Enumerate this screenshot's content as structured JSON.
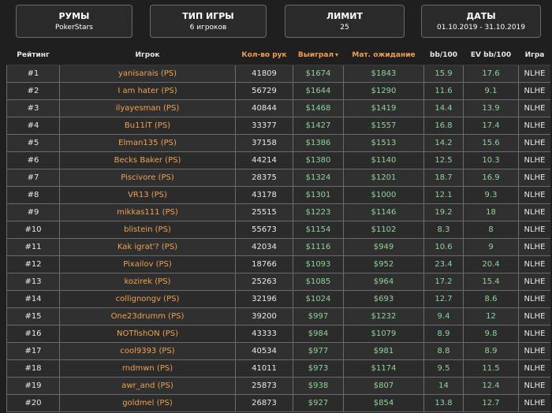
{
  "filters": [
    {
      "title": "РУМЫ",
      "value": "PokerStars"
    },
    {
      "title": "ТИП ИГРЫ",
      "value": "6 игроков"
    },
    {
      "title": "ЛИМИТ",
      "value": "25"
    },
    {
      "title": "ДАТЫ",
      "value": "01.10.2019 - 31.10.2019"
    }
  ],
  "columns": {
    "rank": "Рейтинг",
    "player": "Игрок",
    "hands": "Кол-во рук",
    "won": "Выиграл",
    "won_sort_icon": "caret-down-icon",
    "ev": "Мат. ожидание",
    "bb100": "bb/100",
    "evbb100": "EV bb/100",
    "game": "Игра"
  },
  "sort_arrow": "▾",
  "colors": {
    "accent": "#f0a050",
    "positive": "#8fd39a"
  },
  "rows": [
    {
      "rank": "#1",
      "player": "yanisarais (PS)",
      "hands": "41809",
      "won": "$1674",
      "ev": "$1843",
      "bb100": "15.9",
      "evbb100": "17.6",
      "game": "NLHE"
    },
    {
      "rank": "#2",
      "player": "I am hater (PS)",
      "hands": "56729",
      "won": "$1644",
      "ev": "$1290",
      "bb100": "11.6",
      "evbb100": "9.1",
      "game": "NLHE"
    },
    {
      "rank": "#3",
      "player": "ilyayesman (PS)",
      "hands": "40844",
      "won": "$1468",
      "ev": "$1419",
      "bb100": "14.4",
      "evbb100": "13.9",
      "game": "NLHE"
    },
    {
      "rank": "#4",
      "player": "Bu11iT (PS)",
      "hands": "33377",
      "won": "$1427",
      "ev": "$1557",
      "bb100": "16.8",
      "evbb100": "17.4",
      "game": "NLHE"
    },
    {
      "rank": "#5",
      "player": "Elman135 (PS)",
      "hands": "37158",
      "won": "$1386",
      "ev": "$1513",
      "bb100": "14.2",
      "evbb100": "15.6",
      "game": "NLHE"
    },
    {
      "rank": "#6",
      "player": "Becks Baker (PS)",
      "hands": "44214",
      "won": "$1380",
      "ev": "$1140",
      "bb100": "12.5",
      "evbb100": "10.3",
      "game": "NLHE"
    },
    {
      "rank": "#7",
      "player": "Piscivore (PS)",
      "hands": "28375",
      "won": "$1324",
      "ev": "$1201",
      "bb100": "18.7",
      "evbb100": "16.9",
      "game": "NLHE"
    },
    {
      "rank": "#8",
      "player": "VR13 (PS)",
      "hands": "43178",
      "won": "$1301",
      "ev": "$1000",
      "bb100": "12.1",
      "evbb100": "9.3",
      "game": "NLHE"
    },
    {
      "rank": "#9",
      "player": "mikkas111 (PS)",
      "hands": "25515",
      "won": "$1223",
      "ev": "$1146",
      "bb100": "19.2",
      "evbb100": "18",
      "game": "NLHE"
    },
    {
      "rank": "#10",
      "player": "blistein (PS)",
      "hands": "55673",
      "won": "$1154",
      "ev": "$1102",
      "bb100": "8.3",
      "evbb100": "8",
      "game": "NLHE"
    },
    {
      "rank": "#11",
      "player": "Kak igrat'? (PS)",
      "hands": "42034",
      "won": "$1116",
      "ev": "$949",
      "bb100": "10.6",
      "evbb100": "9",
      "game": "NLHE"
    },
    {
      "rank": "#12",
      "player": "Pixailov (PS)",
      "hands": "18766",
      "won": "$1093",
      "ev": "$952",
      "bb100": "23.4",
      "evbb100": "20.4",
      "game": "NLHE"
    },
    {
      "rank": "#13",
      "player": "kozirek (PS)",
      "hands": "25263",
      "won": "$1085",
      "ev": "$964",
      "bb100": "17.2",
      "evbb100": "15.4",
      "game": "NLHE"
    },
    {
      "rank": "#14",
      "player": "collignongv (PS)",
      "hands": "32196",
      "won": "$1024",
      "ev": "$693",
      "bb100": "12.7",
      "evbb100": "8.6",
      "game": "NLHE"
    },
    {
      "rank": "#15",
      "player": "One23drumm (PS)",
      "hands": "39200",
      "won": "$997",
      "ev": "$1232",
      "bb100": "9.4",
      "evbb100": "12",
      "game": "NLHE"
    },
    {
      "rank": "#16",
      "player": "NOTfishON (PS)",
      "hands": "43333",
      "won": "$984",
      "ev": "$1079",
      "bb100": "8.9",
      "evbb100": "9.8",
      "game": "NLHE"
    },
    {
      "rank": "#17",
      "player": "cool9393 (PS)",
      "hands": "40534",
      "won": "$977",
      "ev": "$981",
      "bb100": "8.8",
      "evbb100": "8.9",
      "game": "NLHE"
    },
    {
      "rank": "#18",
      "player": "rndmwn (PS)",
      "hands": "41011",
      "won": "$973",
      "ev": "$1174",
      "bb100": "9.5",
      "evbb100": "11.5",
      "game": "NLHE"
    },
    {
      "rank": "#19",
      "player": "awr_and (PS)",
      "hands": "25873",
      "won": "$938",
      "ev": "$807",
      "bb100": "14",
      "evbb100": "12.4",
      "game": "NLHE"
    },
    {
      "rank": "#20",
      "player": "goldmel (PS)",
      "hands": "26873",
      "won": "$927",
      "ev": "$854",
      "bb100": "13.8",
      "evbb100": "12.7",
      "game": "NLHE"
    }
  ]
}
